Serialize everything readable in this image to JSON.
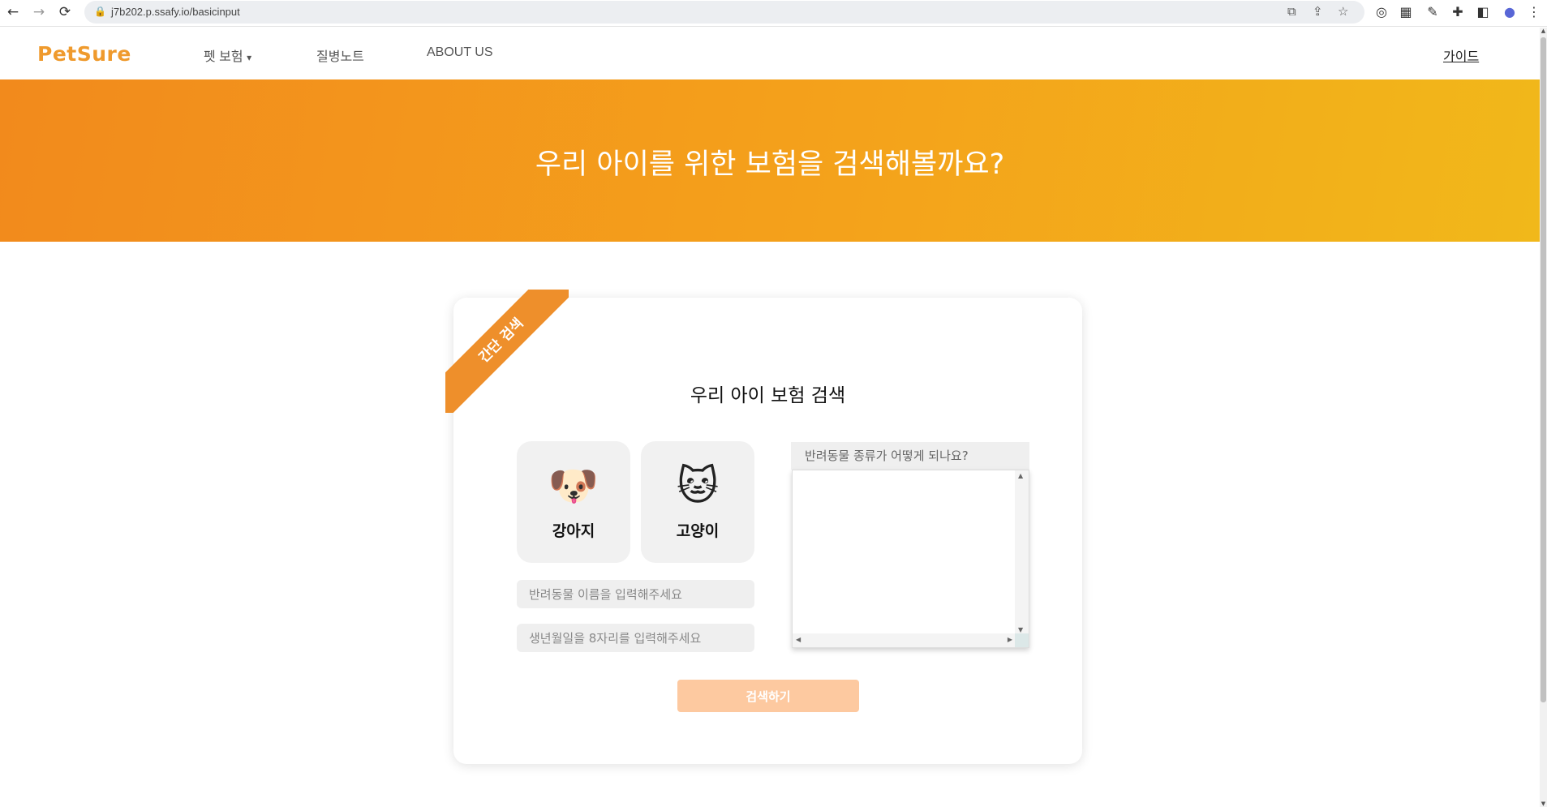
{
  "browser": {
    "url": "j7b202.p.ssafy.io/basicinput",
    "back_icon": "←",
    "forward_icon": "→",
    "reload_icon": "⟳"
  },
  "nav": {
    "logo": "PetSure",
    "menu": [
      "펫 보험",
      "질병노트",
      "ABOUT US"
    ],
    "dropdown_caret": "▾",
    "guide": "가이드"
  },
  "hero": {
    "title": "우리 아이를 위한 보험을 검색해볼까요?"
  },
  "card": {
    "ribbon": "간단 검색",
    "title": "우리 아이 보험 검색",
    "pets": [
      {
        "label": "강아지",
        "icon": "🐶"
      },
      {
        "label": "고양이",
        "icon": "🐱"
      }
    ],
    "name_placeholder": "반려동물 이름을 입력해주세요",
    "birth_placeholder": "생년월일을 8자리를 입력해주세요",
    "species_placeholder": "반려동물 종류가 어떻게 되나요?",
    "search_button": "검색하기"
  },
  "colors": {
    "brand": "#ef9a2d",
    "hero_start": "#f28a1c",
    "hero_end": "#f1b81a",
    "button_disabled": "#fdc9a0"
  }
}
